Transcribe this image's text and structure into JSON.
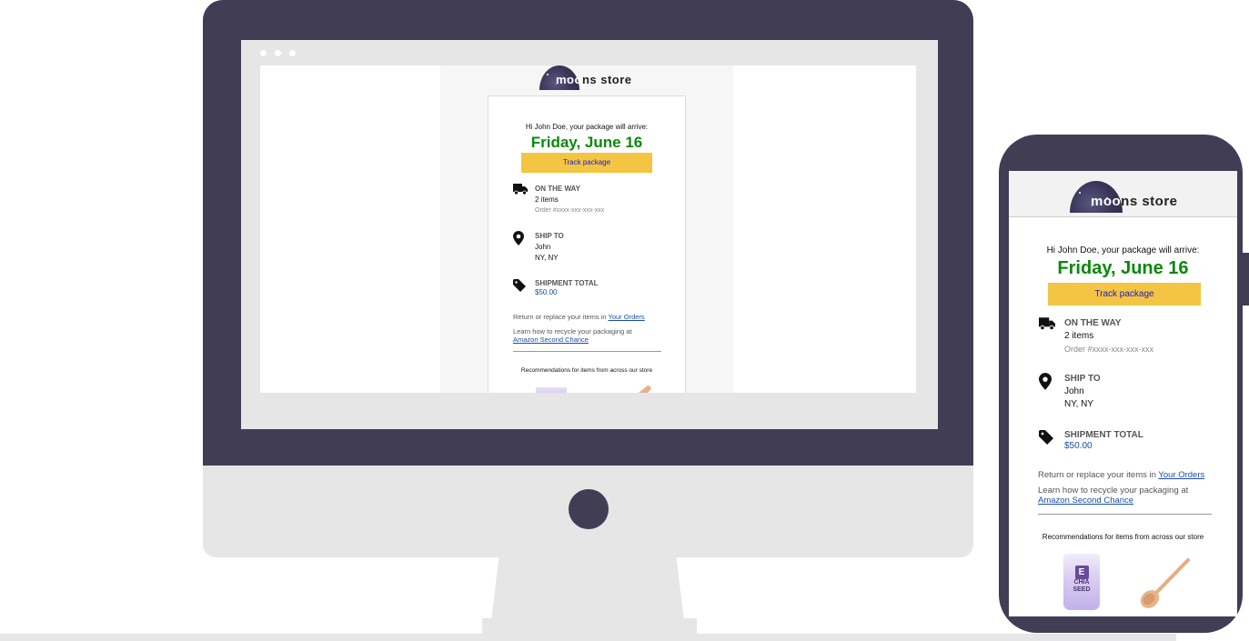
{
  "brand": {
    "name_white": "moo",
    "name_dark": "ns store"
  },
  "email": {
    "greeting": "Hi John Doe, your package will arrive:",
    "arrival_date": "Friday, June 16",
    "track_button": "Track package",
    "status": {
      "label": "ON THE WAY",
      "items": "2 items",
      "order": "Order #xxxx-xxx-xxx-xxx"
    },
    "ship_to": {
      "label": "SHIP TO",
      "name": "John",
      "city": "NY, NY"
    },
    "shipment_total": {
      "label": "SHIPMENT TOTAL",
      "amount": "$50.00"
    },
    "return_text": "Return or replace your items in ",
    "return_link": "Your Orders",
    "recycle_text": "Learn how to recycle your packaging at",
    "recycle_link": "Amazon Second Chance",
    "recommendations": "Recommendations for items from across our store",
    "product_1": {
      "line1": "CHIA",
      "line2": "SEED",
      "badge": "E"
    }
  },
  "icons": {
    "status": "truck-icon",
    "ship_to": "map-pin-icon",
    "total": "price-tag-icon"
  },
  "colors": {
    "device": "#403d55",
    "device_light": "#e6e6e6",
    "date_green": "#0a8a0a",
    "button_yellow": "#f4c542",
    "link_blue": "#1a4ea8"
  }
}
